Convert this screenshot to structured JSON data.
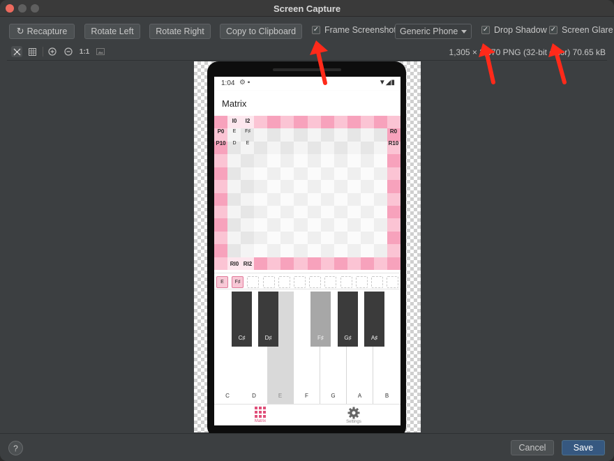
{
  "window": {
    "title": "Screen Capture"
  },
  "toolbar": {
    "recapture_label": "Recapture",
    "rotate_left_label": "Rotate Left",
    "rotate_right_label": "Rotate Right",
    "copy_label": "Copy to Clipboard",
    "frame_screenshot": {
      "label": "Frame Screenshot",
      "checked": true
    },
    "device_select": {
      "value": "Generic Phone"
    },
    "drop_shadow": {
      "label": "Drop Shadow",
      "checked": true
    },
    "screen_glare": {
      "label": "Screen Glare",
      "checked": true
    }
  },
  "toolbar2": {
    "actual_size_label": "1:1",
    "info_text": "1,305 × 2,670 PNG (32-bit color) 70.65 kB"
  },
  "phone": {
    "status_time": "1:04",
    "app_title": "Matrix",
    "matrix_labels": {
      "top": [
        "I0",
        "I2"
      ],
      "row0_left": "P0",
      "row0_right": "R0",
      "row1_left": "P10",
      "row1_right": "R10",
      "row0_notes": [
        "E",
        "F♯"
      ],
      "row1_notes": [
        "D",
        "E"
      ],
      "bottom": [
        "RI0",
        "RI2"
      ]
    },
    "selected_notes": [
      "E",
      "F♯"
    ],
    "keyboard": {
      "white_keys": [
        "C",
        "D",
        "E",
        "F",
        "G",
        "A",
        "B"
      ],
      "selected_white": "E",
      "black_keys": [
        "C♯",
        "D♯",
        "F♯",
        "G♯",
        "A♯"
      ],
      "selected_black": "F♯"
    },
    "nav": {
      "matrix_label": "Matrix",
      "settings_label": "Settings"
    },
    "accent_color": "#e0507a"
  },
  "footer": {
    "help_label": "?",
    "cancel_label": "Cancel",
    "save_label": "Save"
  },
  "colors": {
    "annotation_arrow": "#ff2a1a",
    "save_button": "#365880"
  }
}
